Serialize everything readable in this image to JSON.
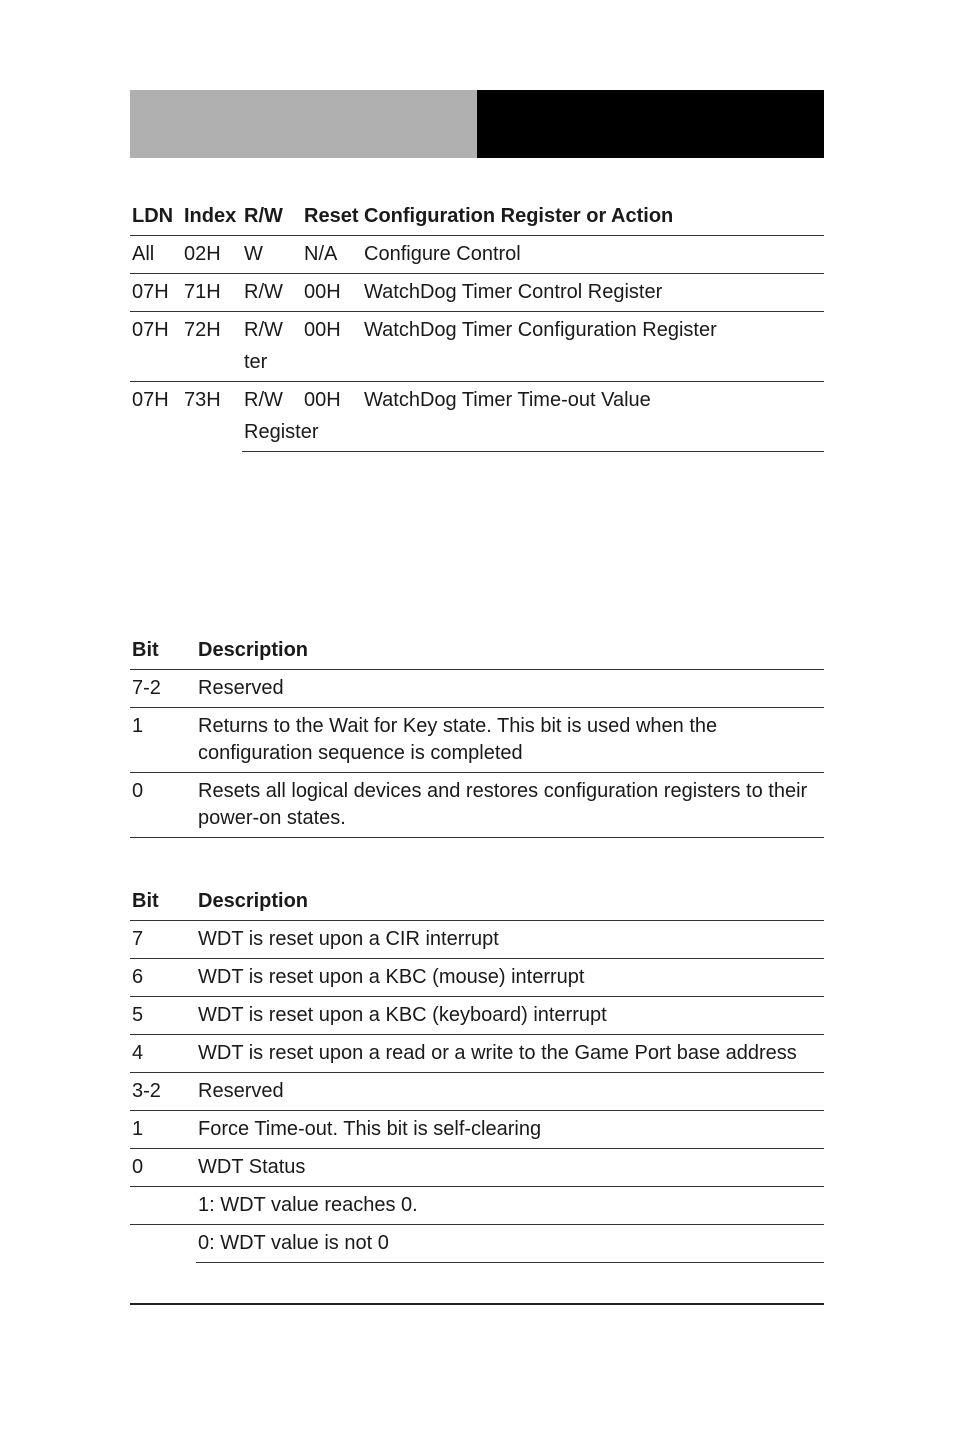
{
  "table1": {
    "headers": {
      "ldn": "LDN",
      "index": "Index",
      "rw": "R/W",
      "reset": "Reset",
      "config": "Configuration Register or Action"
    },
    "rows": [
      {
        "ldn": "All",
        "index": "02H",
        "rw": "W",
        "reset": "N/A",
        "config": "Configure Control"
      },
      {
        "ldn": "07H",
        "index": "71H",
        "rw": "R/W",
        "reset": "00H",
        "config": "WatchDog Timer Control Register"
      },
      {
        "ldn": "07H",
        "index": "72H",
        "rw": "R/W",
        "reset": "00H",
        "config": "WatchDog Timer Configuration Register",
        "rw_cont": "ter"
      },
      {
        "ldn": "07H",
        "index": "73H",
        "rw": "R/W",
        "reset": "00H",
        "config": "WatchDog Timer Time-out Value",
        "rw_cont": "Register"
      }
    ]
  },
  "table2": {
    "headers": {
      "bit": "Bit",
      "desc": "Description"
    },
    "rows": [
      {
        "bit": "7-2",
        "desc": "Reserved"
      },
      {
        "bit": "1",
        "desc": "Returns to the Wait for Key state. This bit is used when the configuration sequence is completed"
      },
      {
        "bit": "0",
        "desc": "Resets all logical devices and restores configuration registers to their power-on states."
      }
    ]
  },
  "table3": {
    "headers": {
      "bit": "Bit",
      "desc": "Description"
    },
    "rows": [
      {
        "bit": "7",
        "desc": "WDT is reset upon a CIR interrupt"
      },
      {
        "bit": "6",
        "desc": "WDT is reset upon a KBC (mouse) interrupt"
      },
      {
        "bit": "5",
        "desc": "WDT is reset upon a KBC (keyboard) interrupt"
      },
      {
        "bit": "4",
        "desc": "WDT is reset upon a read or a write to the Game Port base address"
      },
      {
        "bit": "3-2",
        "desc": "Reserved"
      },
      {
        "bit": "1",
        "desc": "Force Time-out. This bit is self-clearing"
      },
      {
        "bit": "0",
        "desc": "WDT Status"
      }
    ],
    "extra": [
      "1: WDT value reaches 0.",
      "0: WDT value is not 0"
    ]
  }
}
